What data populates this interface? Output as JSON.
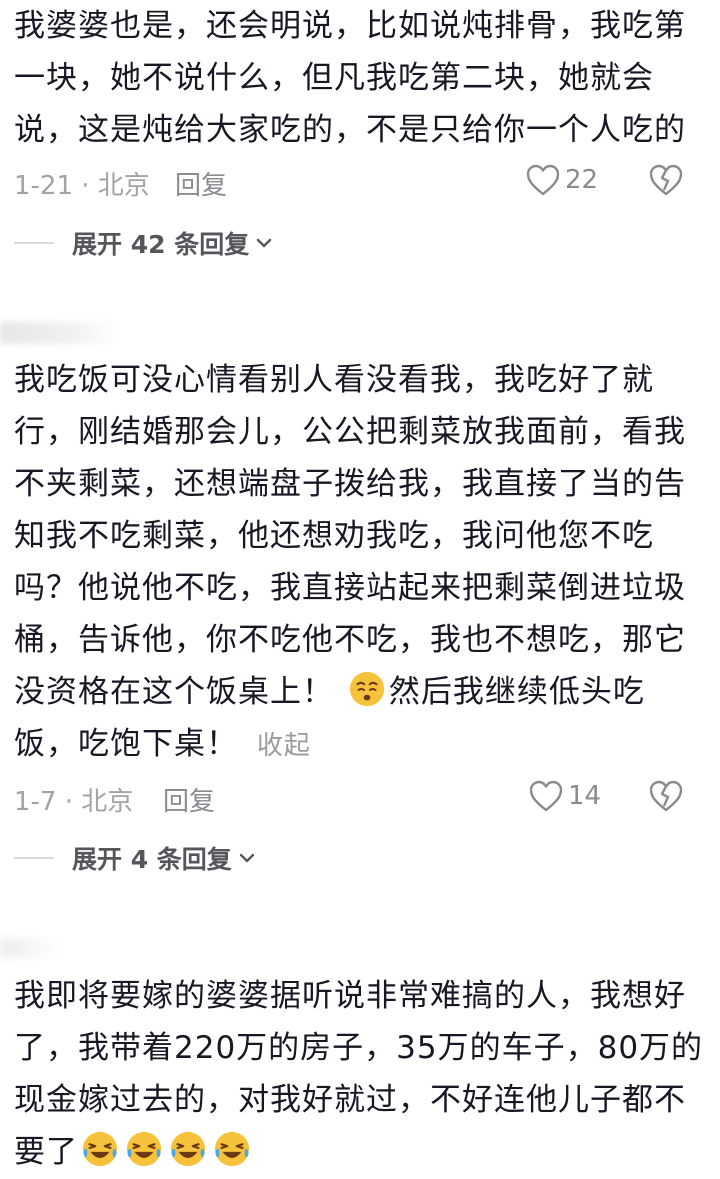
{
  "comments": [
    {
      "text": "我婆婆也是，还会明说，比如说炖排骨，我吃第一块，她不说什么，但凡我吃第二块，她就会说，这是炖给大家吃的，不是只给你一个人吃的",
      "meta": "1-21 · 北京",
      "reply_label": "回复",
      "likes": "22",
      "expand_label": "展开 42 条回复"
    },
    {
      "text": "我吃饭可没心情看别人看没看我，我吃好了就行，刚结婚那会儿，公公把剩菜放我面前，看我不夹剩菜，还想端盘子拨给我，我直接了当的告知我不吃剩菜，他还想劝我吃，我问他您不吃吗？他说他不吃，我直接站起来把剩菜倒进垃圾桶，告诉他，你不吃他不吃，我也不想吃，那它没资格在这个饭桌上！",
      "text_after_emoji": "然后我继续低头吃饭，吃饱下桌！",
      "emoji": "weary-face-emoji",
      "collapse_label": "收起",
      "meta": "1-7 · 北京",
      "reply_label": "回复",
      "likes": "14",
      "expand_label": "展开 4 条回复"
    },
    {
      "text": "我即将要嫁的婆婆据听说非常难搞的人，我想好了，我带着220万的房子，35万的车子，80万的现金嫁过去的，对我好就过，不好连他儿子都不要了",
      "emojis": [
        "laughing-crying-emoji",
        "laughing-crying-emoji",
        "laughing-crying-emoji",
        "laughing-crying-emoji"
      ]
    }
  ],
  "colors": {
    "text": "#161823",
    "meta": "#a2a3a8",
    "expand": "#55565c",
    "emoji_yellow": "#f7c23b"
  }
}
